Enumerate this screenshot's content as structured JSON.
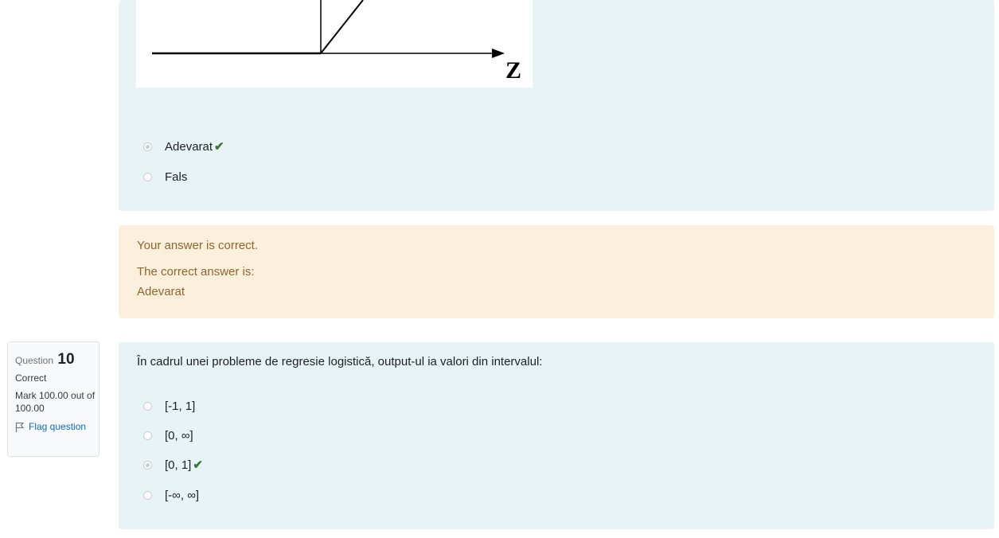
{
  "question9": {
    "figure": {
      "axis_label": "Z"
    },
    "answers": [
      {
        "label": "Adevarat",
        "checked": true,
        "correct": true
      },
      {
        "label": "Fals",
        "checked": false,
        "correct": false
      }
    ],
    "feedback": {
      "status": "Your answer is correct.",
      "correct_prefix": "The correct answer is:",
      "correct_value": "Adevarat"
    }
  },
  "question10": {
    "info": {
      "label": "Question",
      "number": "10",
      "state": "Correct",
      "mark": "Mark 100.00 out of 100.00",
      "flag": "Flag question"
    },
    "text": "În cadrul unei probleme de regresie logistică, output-ul ia valori din intervalul:",
    "answers": [
      {
        "label": "[-1, 1]",
        "checked": false,
        "correct": false
      },
      {
        "label": "[0, ∞]",
        "checked": false,
        "correct": false
      },
      {
        "label": "[0, 1]",
        "checked": true,
        "correct": true
      },
      {
        "label": "[-∞, ∞]",
        "checked": false,
        "correct": false
      }
    ]
  },
  "icons": {
    "tick": "check-icon",
    "flag": "flag-icon"
  },
  "colors": {
    "question_bg": "#e7f3f5",
    "feedback_bg": "#fcefdc",
    "tick": "#357a32",
    "link": "#0f6cbf"
  }
}
